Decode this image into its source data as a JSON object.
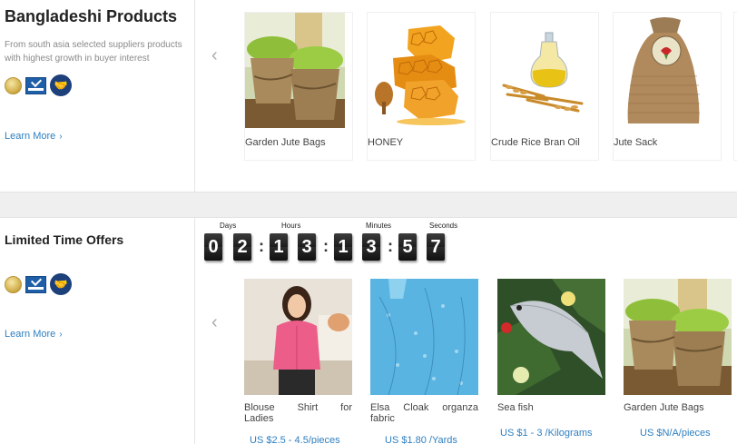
{
  "section1": {
    "title": "Bangladeshi Products",
    "description": "From south asia selected suppliers products with highest growth in buyer interest",
    "learn_more": "Learn More",
    "products": [
      {
        "name": "Garden Jute Bags"
      },
      {
        "name": "HONEY"
      },
      {
        "name": "Crude Rice Bran Oil"
      },
      {
        "name": "Jute Sack"
      }
    ]
  },
  "section2": {
    "title": "Limited Time Offers",
    "learn_more": "Learn More",
    "countdown": {
      "labels": {
        "days": "Days",
        "hours": "Hours",
        "minutes": "Minutes",
        "seconds": "Seconds"
      },
      "digits": {
        "d1": "0",
        "d2": "2",
        "h1": "1",
        "h2": "3",
        "m1": "1",
        "m2": "3",
        "s1": "5",
        "s2": "7"
      },
      "separator": ":"
    },
    "products": [
      {
        "name_words": [
          "Blouse",
          "Shirt",
          "for"
        ],
        "name_line2": "Ladies",
        "price": "US $2.5 - 4.5/pieces"
      },
      {
        "name_words": [
          "Elsa",
          "Cloak",
          "organza"
        ],
        "name_line2": "fabric",
        "price": "US $1.80 /Yards"
      },
      {
        "name": "Sea fish",
        "price": "US $1 - 3 /Kilograms"
      },
      {
        "name": "Garden Jute Bags",
        "price": "US $N/A/pieces"
      }
    ]
  },
  "icons": {
    "prev": "chevron-left-icon",
    "learn_more": "chevron-right-icon",
    "badges": [
      "gold-supplier-icon",
      "verified-icon",
      "trade-assurance-icon"
    ]
  },
  "colors": {
    "link": "#2e7fc0",
    "divider_band": "#efefef"
  }
}
